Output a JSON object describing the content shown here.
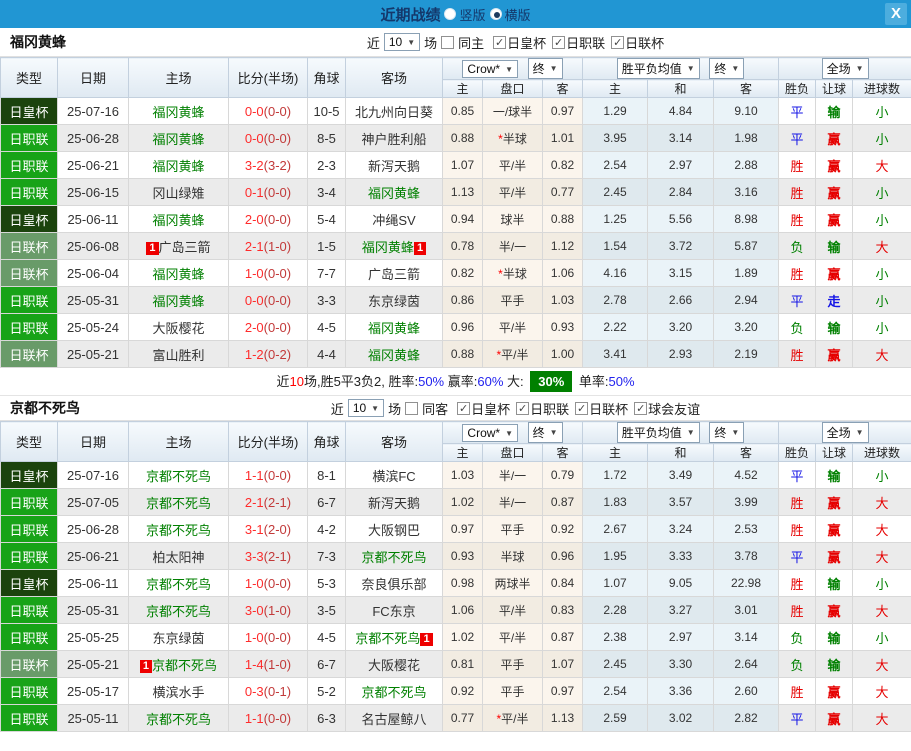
{
  "titlebar": {
    "title": "近期战绩",
    "radio_vertical": "竖版",
    "radio_horizontal": "横版",
    "close": "X"
  },
  "labels": {
    "near": "近",
    "games_suffix": "场",
    "left_columns": [
      "类型",
      "日期",
      "主场",
      "比分(半场)",
      "角球",
      "客场"
    ],
    "sub_columns": [
      "主",
      "盘口",
      "客",
      "主",
      "和",
      "客",
      "胜负",
      "让球",
      "进球数"
    ],
    "ah_source": "Crow*",
    "ah_stage": "终",
    "odds_source": "胜平负均值",
    "odds_stage": "终",
    "scope": "全场"
  },
  "colors": {
    "titlebar": "#2196d3",
    "cup_badge": "#1b430d",
    "league_badge": "#18a318",
    "lcup_badge": "#699b69",
    "win": "#e60000",
    "lose": "#008000",
    "draw": "#1414e6",
    "summary_highlight": "#008000"
  },
  "sections": [
    {
      "team": "福冈黄蜂",
      "filter": {
        "games": "10",
        "same_label": "同主",
        "same_checked": false,
        "leagues": [
          "日皇杯",
          "日职联",
          "日联杯"
        ]
      },
      "rows": [
        {
          "type": "日皇杯",
          "tc": "cup",
          "date": "25-07-16",
          "home": {
            "n": "福冈黄蜂",
            "g": true
          },
          "ft": "0-0",
          "ht": "(0-0)",
          "corner": "10-5",
          "away": {
            "n": "北九州向日葵",
            "g": false
          },
          "ah": [
            "0.85",
            "一/球半",
            "0.97"
          ],
          "star": false,
          "odds": [
            "1.29",
            "4.84",
            "9.10"
          ],
          "res": [
            [
              "平",
              "b"
            ],
            [
              "输",
              "g"
            ],
            [
              "小",
              "g"
            ]
          ]
        },
        {
          "type": "日职联",
          "tc": "jl",
          "date": "25-06-28",
          "home": {
            "n": "福冈黄蜂",
            "g": true
          },
          "ft": "0-0",
          "ht": "(0-0)",
          "corner": "8-5",
          "away": {
            "n": "神户胜利船",
            "g": false
          },
          "ah": [
            "0.88",
            "半球",
            "1.01"
          ],
          "star": true,
          "odds": [
            "3.95",
            "3.14",
            "1.98"
          ],
          "res": [
            [
              "平",
              "b"
            ],
            [
              "赢",
              "r"
            ],
            [
              "小",
              "g"
            ]
          ]
        },
        {
          "type": "日职联",
          "tc": "jl",
          "date": "25-06-21",
          "home": {
            "n": "福冈黄蜂",
            "g": true
          },
          "ft": "3-2",
          "ht": "(3-2)",
          "corner": "2-3",
          "away": {
            "n": "新泻天鹅",
            "g": false
          },
          "ah": [
            "1.07",
            "平/半",
            "0.82"
          ],
          "star": false,
          "odds": [
            "2.54",
            "2.97",
            "2.88"
          ],
          "res": [
            [
              "胜",
              "r"
            ],
            [
              "赢",
              "r"
            ],
            [
              "大",
              "r"
            ]
          ]
        },
        {
          "type": "日职联",
          "tc": "jl",
          "date": "25-06-15",
          "home": {
            "n": "冈山绿雉",
            "g": false
          },
          "ft": "0-1",
          "ht": "(0-0)",
          "corner": "3-4",
          "away": {
            "n": "福冈黄蜂",
            "g": true
          },
          "ah": [
            "1.13",
            "平/半",
            "0.77"
          ],
          "star": false,
          "odds": [
            "2.45",
            "2.84",
            "3.16"
          ],
          "res": [
            [
              "胜",
              "r"
            ],
            [
              "赢",
              "r"
            ],
            [
              "小",
              "g"
            ]
          ]
        },
        {
          "type": "日皇杯",
          "tc": "cup",
          "date": "25-06-11",
          "home": {
            "n": "福冈黄蜂",
            "g": true
          },
          "ft": "2-0",
          "ht": "(0-0)",
          "corner": "5-4",
          "away": {
            "n": "冲绳SV",
            "g": false
          },
          "ah": [
            "0.94",
            "球半",
            "0.88"
          ],
          "star": false,
          "odds": [
            "1.25",
            "5.56",
            "8.98"
          ],
          "res": [
            [
              "胜",
              "r"
            ],
            [
              "赢",
              "r"
            ],
            [
              "小",
              "g"
            ]
          ]
        },
        {
          "type": "日联杯",
          "tc": "lc",
          "date": "25-06-08",
          "home": {
            "n": "广岛三箭",
            "g": false,
            "pre": "1"
          },
          "ft": "2-1",
          "ht": "(1-0)",
          "corner": "1-5",
          "away": {
            "n": "福冈黄蜂",
            "g": true,
            "post": "1"
          },
          "ah": [
            "0.78",
            "半/一",
            "1.12"
          ],
          "star": false,
          "odds": [
            "1.54",
            "3.72",
            "5.87"
          ],
          "res": [
            [
              "负",
              "g"
            ],
            [
              "输",
              "g"
            ],
            [
              "大",
              "r"
            ]
          ]
        },
        {
          "type": "日联杯",
          "tc": "lc",
          "date": "25-06-04",
          "home": {
            "n": "福冈黄蜂",
            "g": true
          },
          "ft": "1-0",
          "ht": "(0-0)",
          "corner": "7-7",
          "away": {
            "n": "广岛三箭",
            "g": false
          },
          "ah": [
            "0.82",
            "半球",
            "1.06"
          ],
          "star": true,
          "odds": [
            "4.16",
            "3.15",
            "1.89"
          ],
          "res": [
            [
              "胜",
              "r"
            ],
            [
              "赢",
              "r"
            ],
            [
              "小",
              "g"
            ]
          ]
        },
        {
          "type": "日职联",
          "tc": "jl",
          "date": "25-05-31",
          "home": {
            "n": "福冈黄蜂",
            "g": true
          },
          "ft": "0-0",
          "ht": "(0-0)",
          "corner": "3-3",
          "away": {
            "n": "东京绿茵",
            "g": false
          },
          "ah": [
            "0.86",
            "平手",
            "1.03"
          ],
          "star": false,
          "odds": [
            "2.78",
            "2.66",
            "2.94"
          ],
          "res": [
            [
              "平",
              "b"
            ],
            [
              "走",
              "b"
            ],
            [
              "小",
              "g"
            ]
          ]
        },
        {
          "type": "日职联",
          "tc": "jl",
          "date": "25-05-24",
          "home": {
            "n": "大阪樱花",
            "g": false
          },
          "ft": "2-0",
          "ht": "(0-0)",
          "corner": "4-5",
          "away": {
            "n": "福冈黄蜂",
            "g": true
          },
          "ah": [
            "0.96",
            "平/半",
            "0.93"
          ],
          "star": false,
          "odds": [
            "2.22",
            "3.20",
            "3.20"
          ],
          "res": [
            [
              "负",
              "g"
            ],
            [
              "输",
              "g"
            ],
            [
              "小",
              "g"
            ]
          ]
        },
        {
          "type": "日联杯",
          "tc": "lc",
          "date": "25-05-21",
          "home": {
            "n": "富山胜利",
            "g": false
          },
          "ft": "1-2",
          "ht": "(0-2)",
          "corner": "4-4",
          "away": {
            "n": "福冈黄蜂",
            "g": true
          },
          "ah": [
            "0.88",
            "平/半",
            "1.00"
          ],
          "star": true,
          "odds": [
            "3.41",
            "2.93",
            "2.19"
          ],
          "res": [
            [
              "胜",
              "r"
            ],
            [
              "赢",
              "r"
            ],
            [
              "大",
              "r"
            ]
          ]
        }
      ],
      "summary": [
        {
          "t": "近",
          "c": "k"
        },
        {
          "t": "10",
          "c": "r"
        },
        {
          "t": "场,胜5平3负2, 胜率:",
          "c": "k"
        },
        {
          "t": "50%",
          "c": "b"
        },
        {
          "t": " 赢率:",
          "c": "k"
        },
        {
          "t": "60%",
          "c": "b"
        },
        {
          "t": " 大: ",
          "c": "k"
        },
        {
          "t": "30%",
          "c": "gbg"
        },
        {
          "t": " 单率:",
          "c": "k"
        },
        {
          "t": "50%",
          "c": "b"
        }
      ]
    },
    {
      "team": "京都不死鸟",
      "filter": {
        "games": "10",
        "same_label": "同客",
        "same_checked": false,
        "leagues": [
          "日皇杯",
          "日职联",
          "日联杯",
          "球会友谊"
        ]
      },
      "rows": [
        {
          "type": "日皇杯",
          "tc": "cup",
          "date": "25-07-16",
          "home": {
            "n": "京都不死鸟",
            "g": true
          },
          "ft": "1-1",
          "ht": "(0-0)",
          "corner": "8-1",
          "away": {
            "n": "横滨FC",
            "g": false
          },
          "ah": [
            "1.03",
            "半/一",
            "0.79"
          ],
          "star": false,
          "odds": [
            "1.72",
            "3.49",
            "4.52"
          ],
          "res": [
            [
              "平",
              "b"
            ],
            [
              "输",
              "g"
            ],
            [
              "小",
              "g"
            ]
          ]
        },
        {
          "type": "日职联",
          "tc": "jl",
          "date": "25-07-05",
          "home": {
            "n": "京都不死鸟",
            "g": true
          },
          "ft": "2-1",
          "ht": "(2-1)",
          "corner": "6-7",
          "away": {
            "n": "新泻天鹅",
            "g": false
          },
          "ah": [
            "1.02",
            "半/一",
            "0.87"
          ],
          "star": false,
          "odds": [
            "1.83",
            "3.57",
            "3.99"
          ],
          "res": [
            [
              "胜",
              "r"
            ],
            [
              "赢",
              "r"
            ],
            [
              "大",
              "r"
            ]
          ]
        },
        {
          "type": "日职联",
          "tc": "jl",
          "date": "25-06-28",
          "home": {
            "n": "京都不死鸟",
            "g": true
          },
          "ft": "3-1",
          "ht": "(2-0)",
          "corner": "4-2",
          "away": {
            "n": "大阪钢巴",
            "g": false
          },
          "ah": [
            "0.97",
            "平手",
            "0.92"
          ],
          "star": false,
          "odds": [
            "2.67",
            "3.24",
            "2.53"
          ],
          "res": [
            [
              "胜",
              "r"
            ],
            [
              "赢",
              "r"
            ],
            [
              "大",
              "r"
            ]
          ]
        },
        {
          "type": "日职联",
          "tc": "jl",
          "date": "25-06-21",
          "home": {
            "n": "柏太阳神",
            "g": false
          },
          "ft": "3-3",
          "ht": "(2-1)",
          "corner": "7-3",
          "away": {
            "n": "京都不死鸟",
            "g": true
          },
          "ah": [
            "0.93",
            "半球",
            "0.96"
          ],
          "star": false,
          "odds": [
            "1.95",
            "3.33",
            "3.78"
          ],
          "res": [
            [
              "平",
              "b"
            ],
            [
              "赢",
              "r"
            ],
            [
              "大",
              "r"
            ]
          ]
        },
        {
          "type": "日皇杯",
          "tc": "cup",
          "date": "25-06-11",
          "home": {
            "n": "京都不死鸟",
            "g": true
          },
          "ft": "1-0",
          "ht": "(0-0)",
          "corner": "5-3",
          "away": {
            "n": "奈良俱乐部",
            "g": false
          },
          "ah": [
            "0.98",
            "两球半",
            "0.84"
          ],
          "star": false,
          "odds": [
            "1.07",
            "9.05",
            "22.98"
          ],
          "res": [
            [
              "胜",
              "r"
            ],
            [
              "输",
              "g"
            ],
            [
              "小",
              "g"
            ]
          ]
        },
        {
          "type": "日职联",
          "tc": "jl",
          "date": "25-05-31",
          "home": {
            "n": "京都不死鸟",
            "g": true
          },
          "ft": "3-0",
          "ht": "(1-0)",
          "corner": "3-5",
          "away": {
            "n": "FC东京",
            "g": false
          },
          "ah": [
            "1.06",
            "平/半",
            "0.83"
          ],
          "star": false,
          "odds": [
            "2.28",
            "3.27",
            "3.01"
          ],
          "res": [
            [
              "胜",
              "r"
            ],
            [
              "赢",
              "r"
            ],
            [
              "大",
              "r"
            ]
          ]
        },
        {
          "type": "日职联",
          "tc": "jl",
          "date": "25-05-25",
          "home": {
            "n": "东京绿茵",
            "g": false
          },
          "ft": "1-0",
          "ht": "(0-0)",
          "corner": "4-5",
          "away": {
            "n": "京都不死鸟",
            "g": true,
            "post": "1"
          },
          "ah": [
            "1.02",
            "平/半",
            "0.87"
          ],
          "star": false,
          "odds": [
            "2.38",
            "2.97",
            "3.14"
          ],
          "res": [
            [
              "负",
              "g"
            ],
            [
              "输",
              "g"
            ],
            [
              "小",
              "g"
            ]
          ]
        },
        {
          "type": "日联杯",
          "tc": "lc",
          "date": "25-05-21",
          "home": {
            "n": "京都不死鸟",
            "g": true,
            "pre": "1"
          },
          "ft": "1-4",
          "ht": "(1-0)",
          "corner": "6-7",
          "away": {
            "n": "大阪樱花",
            "g": false
          },
          "ah": [
            "0.81",
            "平手",
            "1.07"
          ],
          "star": false,
          "odds": [
            "2.45",
            "3.30",
            "2.64"
          ],
          "res": [
            [
              "负",
              "g"
            ],
            [
              "输",
              "g"
            ],
            [
              "大",
              "r"
            ]
          ]
        },
        {
          "type": "日职联",
          "tc": "jl",
          "date": "25-05-17",
          "home": {
            "n": "横滨水手",
            "g": false
          },
          "ft": "0-3",
          "ht": "(0-1)",
          "corner": "5-2",
          "away": {
            "n": "京都不死鸟",
            "g": true
          },
          "ah": [
            "0.92",
            "平手",
            "0.97"
          ],
          "star": false,
          "odds": [
            "2.54",
            "3.36",
            "2.60"
          ],
          "res": [
            [
              "胜",
              "r"
            ],
            [
              "赢",
              "r"
            ],
            [
              "大",
              "r"
            ]
          ]
        },
        {
          "type": "日职联",
          "tc": "jl",
          "date": "25-05-11",
          "home": {
            "n": "京都不死鸟",
            "g": true
          },
          "ft": "1-1",
          "ht": "(0-0)",
          "corner": "6-3",
          "away": {
            "n": "名古屋鲸八",
            "g": false
          },
          "ah": [
            "0.77",
            "平/半",
            "1.13"
          ],
          "star": true,
          "odds": [
            "2.59",
            "3.02",
            "2.82"
          ],
          "res": [
            [
              "平",
              "b"
            ],
            [
              "赢",
              "r"
            ],
            [
              "大",
              "r"
            ]
          ]
        }
      ]
    }
  ]
}
